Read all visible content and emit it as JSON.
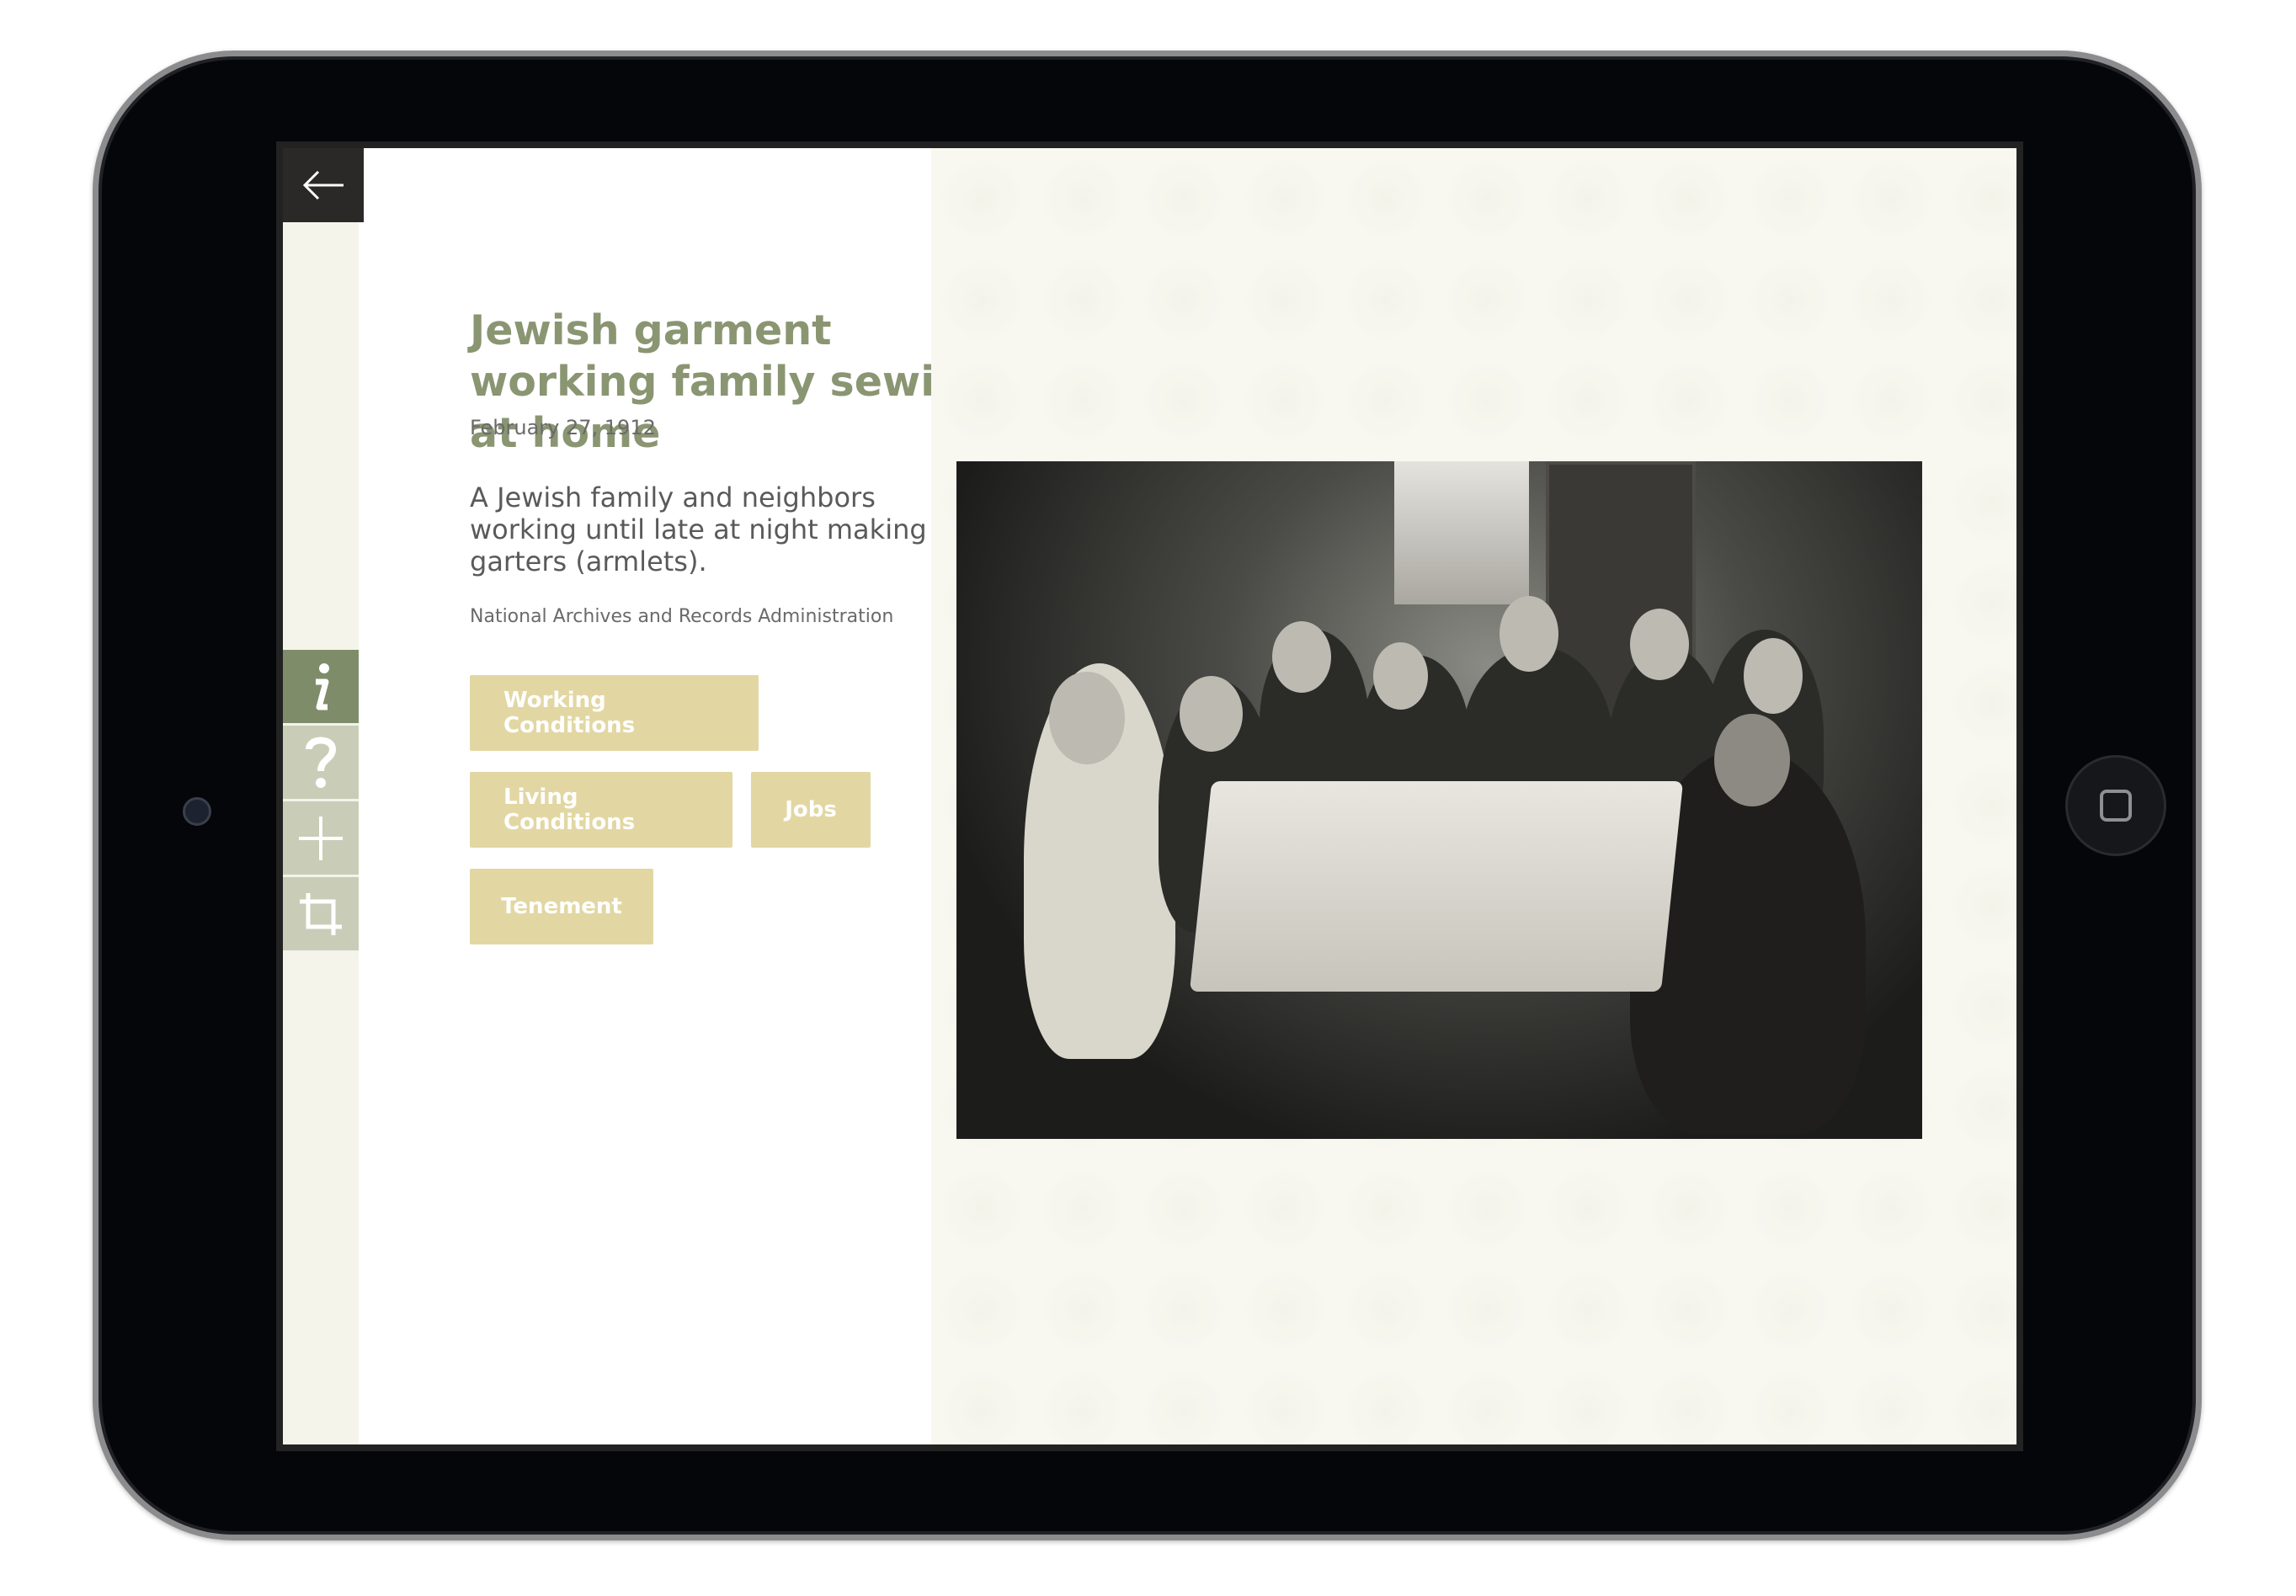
{
  "app": {
    "back_label": "Back",
    "toolbar": [
      {
        "name": "info",
        "icon": "info-icon",
        "active": true
      },
      {
        "name": "question",
        "icon": "question-icon",
        "active": false
      },
      {
        "name": "add",
        "icon": "plus-icon",
        "active": false
      },
      {
        "name": "crop",
        "icon": "crop-icon",
        "active": false
      }
    ]
  },
  "item": {
    "title": "Jewish garment working family sewing at home",
    "date": "February 27, 1912",
    "description": "A Jewish family and neighbors working until late at night making garters (armlets).",
    "source": "National Archives and Records Administration",
    "tags": [
      "Working Conditions",
      "Living Conditions",
      "Jobs",
      "Tenement"
    ]
  },
  "colors": {
    "title": "#8a9572",
    "tag_bg": "#e2d7a3",
    "tool_active": "#7f8c69",
    "tool_inactive": "#c9cdb7",
    "back_bg": "#2b2928"
  }
}
